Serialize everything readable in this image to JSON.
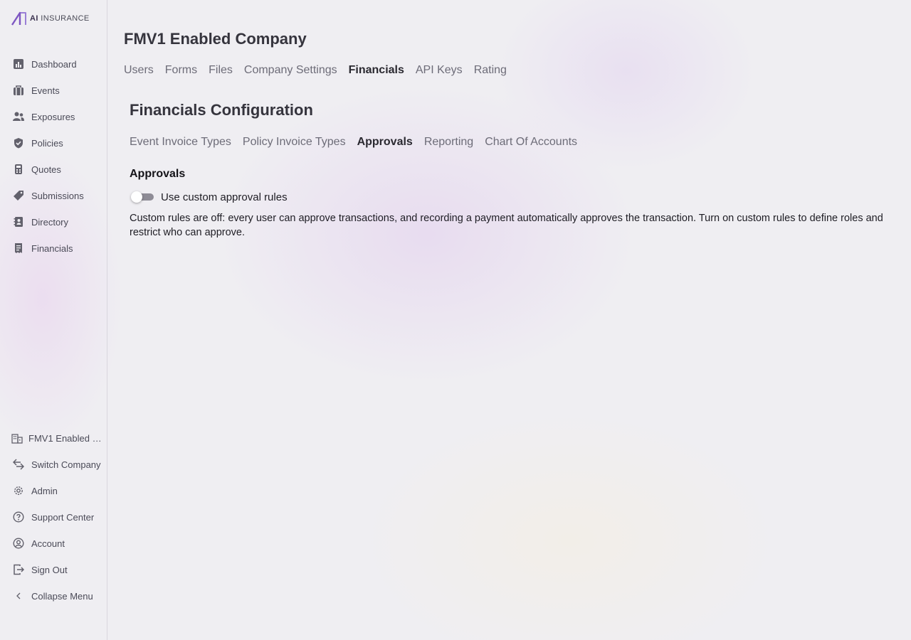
{
  "brand": {
    "logo_text_bold": "AI",
    "logo_text": "INSURANCE",
    "accent_color": "#7e57c2"
  },
  "sidebar": {
    "items": [
      {
        "label": "Dashboard",
        "icon": "chart-bar-icon"
      },
      {
        "label": "Events",
        "icon": "briefcase-icon"
      },
      {
        "label": "Exposures",
        "icon": "users-icon"
      },
      {
        "label": "Policies",
        "icon": "shield-check-icon"
      },
      {
        "label": "Quotes",
        "icon": "calculator-icon"
      },
      {
        "label": "Submissions",
        "icon": "tag-icon"
      },
      {
        "label": "Directory",
        "icon": "address-book-icon"
      },
      {
        "label": "Financials",
        "icon": "receipt-icon"
      }
    ],
    "bottom": [
      {
        "label": "FMV1 Enabled Company",
        "icon": "building-icon"
      },
      {
        "label": "Switch Company",
        "icon": "switch-arrows-icon"
      },
      {
        "label": "Admin",
        "icon": "gear-icon"
      },
      {
        "label": "Support Center",
        "icon": "help-circle-icon"
      },
      {
        "label": "Account",
        "icon": "user-circle-icon"
      },
      {
        "label": "Sign Out",
        "icon": "sign-out-icon"
      },
      {
        "label": "Collapse Menu",
        "icon": "chevron-left-icon"
      }
    ]
  },
  "page": {
    "company_title": "FMV1 Enabled Company",
    "tabs": [
      "Users",
      "Forms",
      "Files",
      "Company Settings",
      "Financials",
      "API Keys",
      "Rating"
    ],
    "active_tab": "Financials"
  },
  "financials": {
    "title": "Financials Configuration",
    "subtabs": [
      "Event Invoice Types",
      "Policy Invoice Types",
      "Approvals",
      "Reporting",
      "Chart Of Accounts"
    ],
    "active_subtab": "Approvals",
    "approvals": {
      "heading": "Approvals",
      "toggle_label": "Use custom approval rules",
      "toggle_on": false,
      "description": "Custom rules are off: every user can approve transactions, and recording a payment automatically approves the transaction. Turn on custom rules to define roles and restrict who can approve."
    }
  }
}
